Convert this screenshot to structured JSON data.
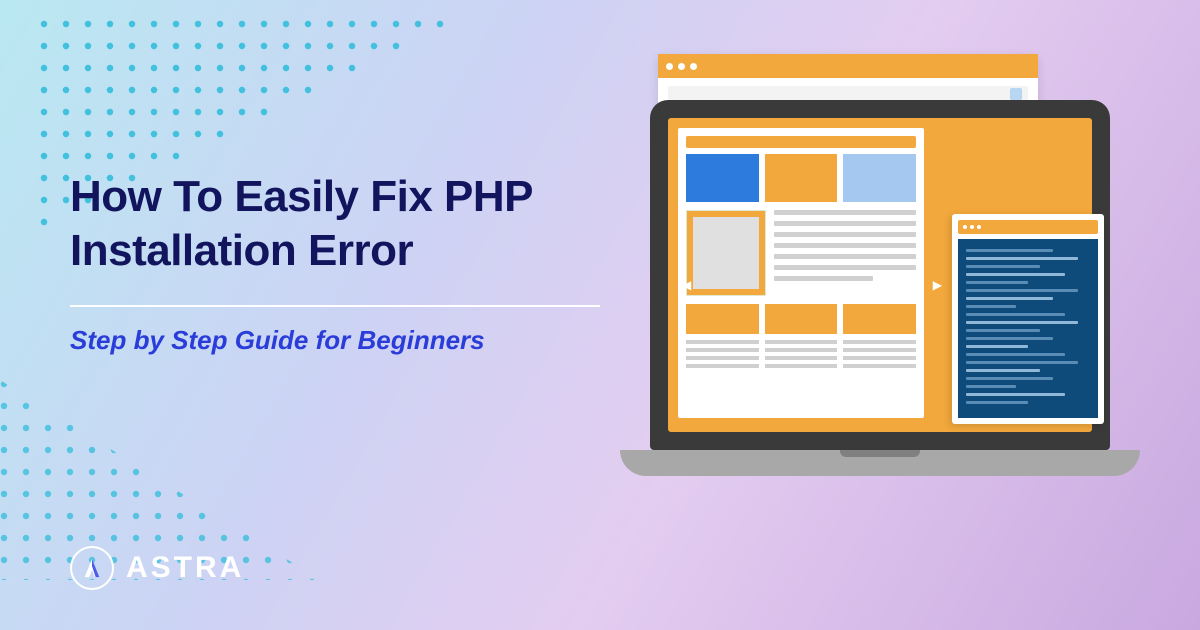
{
  "title_line1": "How To Easily Fix PHP",
  "title_line2": "Installation Error",
  "subtitle": "Step by Step Guide for Beginners",
  "brand_name": "ASTRA"
}
